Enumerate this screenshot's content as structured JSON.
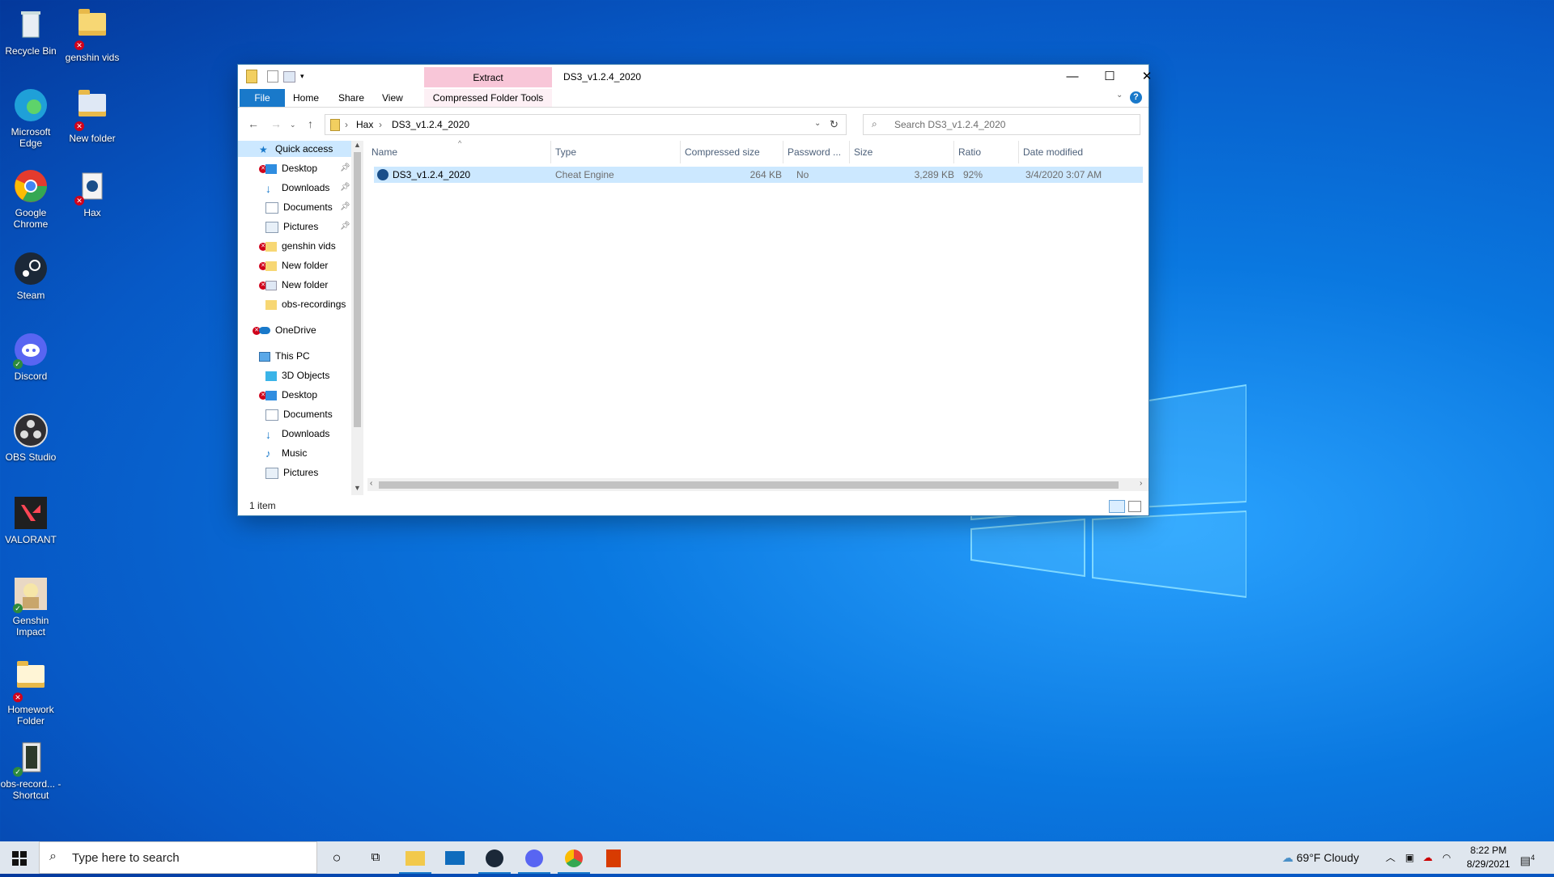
{
  "desktop": {
    "icons": [
      {
        "label": "Recycle Bin",
        "icon": "recycle-bin-icon",
        "badge": ""
      },
      {
        "label": "genshin vids",
        "icon": "folder-icon",
        "badge": "error"
      },
      {
        "label": "Microsoft Edge",
        "icon": "edge-icon",
        "badge": ""
      },
      {
        "label": "New folder",
        "icon": "folder-icon",
        "badge": "error"
      },
      {
        "label": "Google Chrome",
        "icon": "chrome-icon",
        "badge": ""
      },
      {
        "label": "Hax",
        "icon": "cheat-engine-icon",
        "badge": "error"
      },
      {
        "label": "Steam",
        "icon": "steam-icon",
        "badge": ""
      },
      {
        "label": "Discord",
        "icon": "discord-icon",
        "badge": "ok"
      },
      {
        "label": "OBS Studio",
        "icon": "obs-icon",
        "badge": ""
      },
      {
        "label": "VALORANT",
        "icon": "valorant-icon",
        "badge": ""
      },
      {
        "label": "Genshin Impact",
        "icon": "genshin-icon",
        "badge": "ok"
      },
      {
        "label": "Homework Folder",
        "icon": "folder-icon",
        "badge": "error"
      },
      {
        "label": "obs-record... - Shortcut",
        "icon": "shortcut-icon",
        "badge": "ok"
      }
    ]
  },
  "window": {
    "title": "DS3_v1.2.4_2020",
    "context_tab": "Extract",
    "ribbon_tabs": [
      "File",
      "Home",
      "Share",
      "View",
      "Compressed Folder Tools"
    ],
    "breadcrumb": [
      "Hax",
      "DS3_v1.2.4_2020"
    ],
    "search_placeholder": "Search DS3_v1.2.4_2020",
    "nav": {
      "quick_access": "Quick access",
      "quick_items": [
        {
          "label": "Desktop",
          "pinned": true,
          "error": true
        },
        {
          "label": "Downloads",
          "pinned": true,
          "error": false
        },
        {
          "label": "Documents",
          "pinned": true,
          "error": false
        },
        {
          "label": "Pictures",
          "pinned": true,
          "error": false
        },
        {
          "label": "genshin vids",
          "pinned": false,
          "error": true
        },
        {
          "label": "New folder",
          "pinned": false,
          "error": true
        },
        {
          "label": "New folder",
          "pinned": false,
          "error": true
        },
        {
          "label": "obs-recordings",
          "pinned": false,
          "error": false
        }
      ],
      "onedrive": "OneDrive",
      "this_pc": "This PC",
      "pc_items": [
        "3D Objects",
        "Desktop",
        "Documents",
        "Downloads",
        "Music",
        "Pictures"
      ]
    },
    "columns": [
      "Name",
      "Type",
      "Compressed size",
      "Password ...",
      "Size",
      "Ratio",
      "Date modified"
    ],
    "rows": [
      {
        "name": "DS3_v1.2.4_2020",
        "type": "Cheat Engine",
        "compressed": "264 KB",
        "password": "No",
        "size": "3,289 KB",
        "ratio": "92%",
        "modified": "3/4/2020 3:07 AM"
      }
    ],
    "status": "1 item"
  },
  "taskbar": {
    "search_placeholder": "Type here to search",
    "weather": "69°F  Cloudy",
    "time": "8:22 PM",
    "date": "8/29/2021",
    "notification_count": "4"
  },
  "colors": {
    "accent": "#1979ca",
    "context_tab": "#f8c6d8",
    "selection": "#cce8ff"
  }
}
